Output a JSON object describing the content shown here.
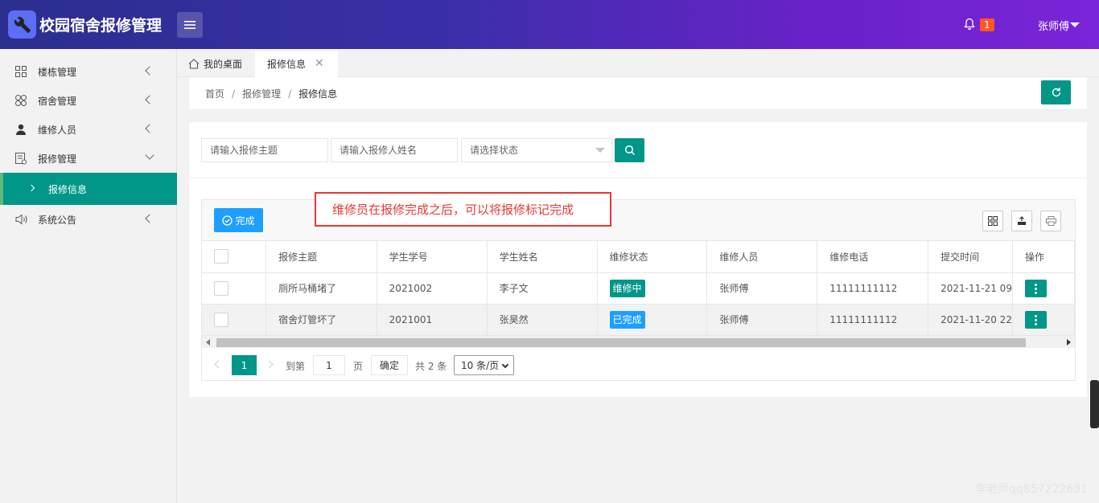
{
  "app": {
    "title": "校园宿舍报修管理"
  },
  "header": {
    "notification_count": "1",
    "user_name": "张师傅"
  },
  "sidebar": {
    "items": [
      {
        "label": "楼栋管理",
        "icon": "grid-icon"
      },
      {
        "label": "宿舍管理",
        "icon": "clover-icon"
      },
      {
        "label": "维修人员",
        "icon": "person-icon"
      },
      {
        "label": "报修管理",
        "icon": "document-icon",
        "expanded": true
      },
      {
        "label": "系统公告",
        "icon": "speaker-icon"
      }
    ],
    "sub_item": {
      "label": "报修信息",
      "active": true
    }
  },
  "tabs": [
    {
      "label": "我的桌面",
      "icon": "home-icon"
    },
    {
      "label": "报修信息",
      "active": true,
      "closable": true
    }
  ],
  "breadcrumb": {
    "items": [
      "首页",
      "报修管理",
      "报修信息"
    ]
  },
  "search": {
    "subject_placeholder": "请输入报修主题",
    "name_placeholder": "请输入报修人姓名",
    "status_placeholder": "请选择状态"
  },
  "toolbar": {
    "complete_label": "完成"
  },
  "annotation": "维修员在报修完成之后，可以将报修标记完成",
  "table": {
    "columns": [
      "报修主题",
      "学生学号",
      "学生姓名",
      "维修状态",
      "维修人员",
      "维修电话",
      "提交时间",
      "操作"
    ],
    "rows": [
      {
        "subject": "厕所马桶堵了",
        "student_id": "2021002",
        "student_name": "李子文",
        "status": "维修中",
        "status_color": "#009688",
        "worker": "张师傅",
        "phone": "11111111112",
        "time": "2021-11-21 09"
      },
      {
        "subject": "宿舍灯管坏了",
        "student_id": "2021001",
        "student_name": "张昊然",
        "status": "已完成",
        "status_color": "#1e9fff",
        "worker": "张师傅",
        "phone": "11111111112",
        "time": "2021-11-20 22"
      }
    ]
  },
  "pagination": {
    "current_page": "1",
    "goto_label": "到第",
    "page_input": "1",
    "page_unit": "页",
    "confirm_label": "确定",
    "total_label": "共 2 条",
    "page_size": "10 条/页"
  },
  "watermark": "李老师qq857222631",
  "colors": {
    "accent": "#009688",
    "blue": "#1e9fff",
    "badge": "#ff5722",
    "header_start": "#2b2e8f",
    "header_end": "#7a24d8"
  }
}
